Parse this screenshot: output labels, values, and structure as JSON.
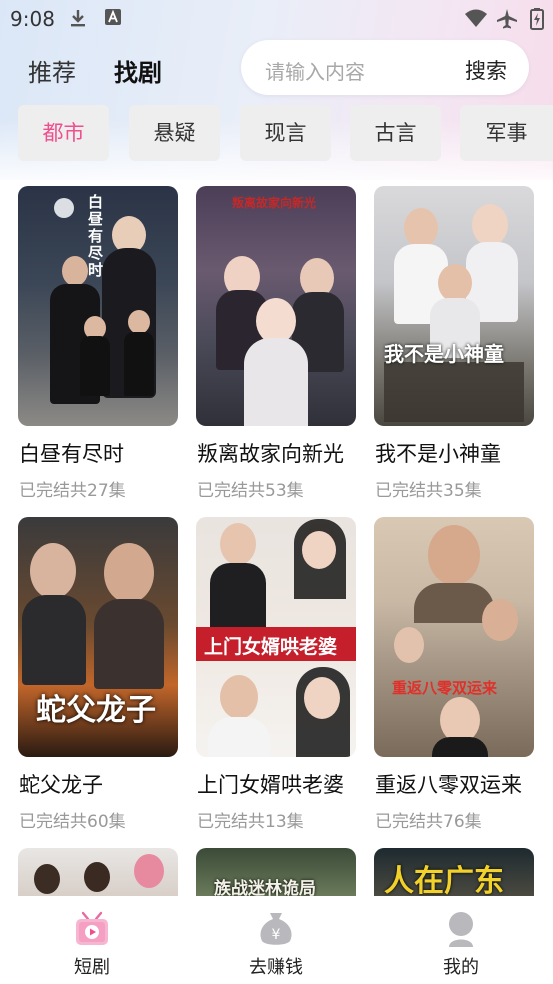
{
  "status_bar": {
    "time": "9:08"
  },
  "header": {
    "tabs": [
      {
        "label": "推荐",
        "active": false
      },
      {
        "label": "找剧",
        "active": true
      }
    ],
    "search": {
      "placeholder": "请输入内容",
      "button_label": "搜索"
    }
  },
  "categories": [
    {
      "label": "都市",
      "active": true
    },
    {
      "label": "悬疑",
      "active": false
    },
    {
      "label": "现言",
      "active": false
    },
    {
      "label": "古言",
      "active": false
    },
    {
      "label": "军事",
      "active": false
    }
  ],
  "dramas": [
    {
      "title": "白昼有尽时",
      "status": "已完结共27集",
      "poster_text": "白昼有尽时"
    },
    {
      "title": "叛离故家向新光",
      "status": "已完结共53集",
      "poster_text": "叛离故家向新光"
    },
    {
      "title": "我不是小神童",
      "status": "已完结共35集",
      "poster_text": "我不是小神童"
    },
    {
      "title": "蛇父龙子",
      "status": "已完结共60集",
      "poster_text": "蛇父龙子"
    },
    {
      "title": "上门女婿哄老婆",
      "status": "已完结共13集",
      "poster_text": "上门女婿哄老婆"
    },
    {
      "title": "重返八零双运来",
      "status": "已完结共76集",
      "poster_text": "重返八零双运来"
    }
  ],
  "partial_posters": [
    {
      "poster_text": ""
    },
    {
      "poster_text": "族战迷林诡局"
    },
    {
      "poster_text": "人在广东"
    }
  ],
  "bottom_nav": [
    {
      "label": "短剧",
      "icon": "short-drama-icon",
      "active": true
    },
    {
      "label": "去赚钱",
      "icon": "money-bag-icon",
      "active": false
    },
    {
      "label": "我的",
      "icon": "profile-icon",
      "active": false
    }
  ],
  "colors": {
    "accent": "#ee4f8e",
    "category_bg": "#eeeeee",
    "subtext": "#999999"
  }
}
